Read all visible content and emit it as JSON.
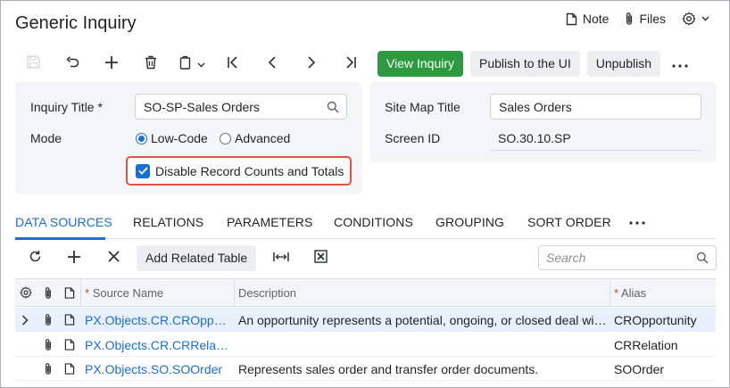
{
  "header": {
    "title": "Generic Inquiry",
    "note_label": "Note",
    "files_label": "Files"
  },
  "toolbar": {
    "view_inquiry_label": "View Inquiry",
    "publish_label": "Publish to the UI",
    "unpublish_label": "Unpublish"
  },
  "form": {
    "inquiry_title_label": "Inquiry Title",
    "inquiry_title_required": "*",
    "inquiry_title_value": "SO-SP-Sales Orders",
    "mode_label": "Mode",
    "mode_options": [
      "Low-Code",
      "Advanced"
    ],
    "mode_selected": "Low-Code",
    "disable_counts_label": "Disable Record Counts and Totals",
    "disable_counts_checked": true,
    "site_map_title_label": "Site Map Title",
    "site_map_title_value": "Sales Orders",
    "screen_id_label": "Screen ID",
    "screen_id_value": "SO.30.10.SP"
  },
  "tabs": {
    "items": [
      "DATA SOURCES",
      "RELATIONS",
      "PARAMETERS",
      "CONDITIONS",
      "GROUPING",
      "SORT ORDER"
    ],
    "active": "DATA SOURCES"
  },
  "grid": {
    "add_related_label": "Add Related Table",
    "search_placeholder": "Search",
    "columns": {
      "source_name": "Source Name",
      "description": "Description",
      "alias": "Alias",
      "required_mark": "*"
    },
    "rows": [
      {
        "source_name": "PX.Objects.CR.CROpp…",
        "description": "An opportunity represents a potential, ongoing, or closed deal wi…",
        "alias": "CROpportunity",
        "selected": true
      },
      {
        "source_name": "PX.Objects.CR.CRRela…",
        "description": "",
        "alias": "CRRelation",
        "selected": false
      },
      {
        "source_name": "PX.Objects.SO.SOOrder",
        "description": "Represents sales order and transfer order documents.",
        "alias": "SOOrder",
        "selected": false
      }
    ]
  },
  "colors": {
    "primary_green": "#2c9b3f",
    "accent_blue": "#1a6fd0",
    "highlight_red": "#e0533d"
  },
  "icons": [
    "note-icon",
    "paperclip-icon",
    "gear-icon",
    "chevron-down-icon",
    "save-icon",
    "undo-icon",
    "plus-icon",
    "trash-icon",
    "copy-paste-icon",
    "first-page-icon",
    "prev-icon",
    "next-icon",
    "last-page-icon",
    "more-icon",
    "search-icon",
    "refresh-icon",
    "close-icon",
    "fit-columns-icon",
    "excel-export-icon",
    "expand-row-icon",
    "document-icon"
  ]
}
